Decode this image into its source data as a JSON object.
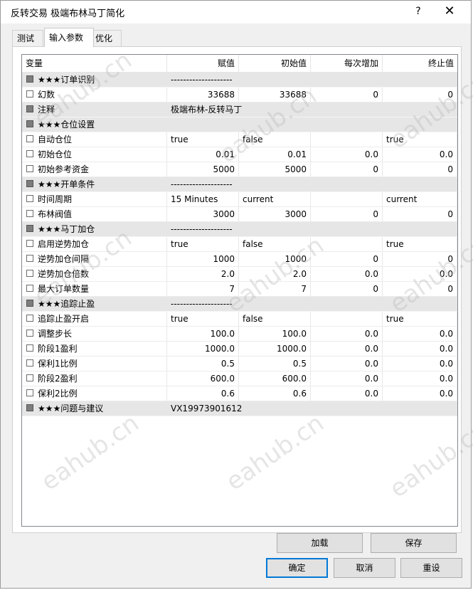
{
  "window": {
    "title": "反转交易 极端布林马丁简化",
    "help_icon": "?",
    "close_icon": "✕"
  },
  "tabs": [
    "测试",
    "输入参数",
    "优化"
  ],
  "table": {
    "headers": [
      "变量",
      "赋值",
      "初始值",
      "每次增加",
      "终止值"
    ],
    "rows": [
      {
        "group": true,
        "name": "★★★订单识别",
        "value": "--------------------",
        "start": "",
        "step": "",
        "stop": ""
      },
      {
        "group": false,
        "name": "幻数",
        "value": "33688",
        "start": "33688",
        "step": "0",
        "stop": "0"
      },
      {
        "group": true,
        "name": "注释",
        "value": "极端布林-反转马丁",
        "start": "",
        "step": "",
        "stop": ""
      },
      {
        "group": true,
        "name": "★★★仓位设置",
        "value": "",
        "start": "",
        "step": "",
        "stop": ""
      },
      {
        "group": false,
        "name": "自动仓位",
        "value": "true",
        "start": "false",
        "step": "",
        "stop": "true"
      },
      {
        "group": false,
        "name": "初始仓位",
        "value": "0.01",
        "start": "0.01",
        "step": "0.0",
        "stop": "0.0"
      },
      {
        "group": false,
        "name": "初始参考资金",
        "value": "5000",
        "start": "5000",
        "step": "0",
        "stop": "0"
      },
      {
        "group": true,
        "name": "★★★开单条件",
        "value": "--------------------",
        "start": "",
        "step": "",
        "stop": ""
      },
      {
        "group": false,
        "name": "时间周期",
        "value": "15 Minutes",
        "start": "current",
        "step": "",
        "stop": "current"
      },
      {
        "group": false,
        "name": "布林阀值",
        "value": "3000",
        "start": "3000",
        "step": "0",
        "stop": "0"
      },
      {
        "group": true,
        "name": "★★★马丁加仓",
        "value": "--------------------",
        "start": "",
        "step": "",
        "stop": ""
      },
      {
        "group": false,
        "name": "启用逆势加仓",
        "value": "true",
        "start": "false",
        "step": "",
        "stop": "true"
      },
      {
        "group": false,
        "name": "逆势加仓间隔",
        "value": "1000",
        "start": "1000",
        "step": "0",
        "stop": "0"
      },
      {
        "group": false,
        "name": "逆势加仓倍数",
        "value": "2.0",
        "start": "2.0",
        "step": "0.0",
        "stop": "0.0"
      },
      {
        "group": false,
        "name": "最大订单数量",
        "value": "7",
        "start": "7",
        "step": "0",
        "stop": "0"
      },
      {
        "group": true,
        "name": "★★★追踪止盈",
        "value": "--------------------",
        "start": "",
        "step": "",
        "stop": ""
      },
      {
        "group": false,
        "name": "追踪止盈开启",
        "value": "true",
        "start": "false",
        "step": "",
        "stop": "true"
      },
      {
        "group": false,
        "name": "调整步长",
        "value": "100.0",
        "start": "100.0",
        "step": "0.0",
        "stop": "0.0"
      },
      {
        "group": false,
        "name": "阶段1盈利",
        "value": "1000.0",
        "start": "1000.0",
        "step": "0.0",
        "stop": "0.0"
      },
      {
        "group": false,
        "name": "保利1比例",
        "value": "0.5",
        "start": "0.5",
        "step": "0.0",
        "stop": "0.0"
      },
      {
        "group": false,
        "name": "阶段2盈利",
        "value": "600.0",
        "start": "600.0",
        "step": "0.0",
        "stop": "0.0"
      },
      {
        "group": false,
        "name": "保利2比例",
        "value": "0.6",
        "start": "0.6",
        "step": "0.0",
        "stop": "0.0"
      },
      {
        "group": true,
        "name": "★★★问题与建议",
        "value": "VX19973901612",
        "start": "",
        "step": "",
        "stop": ""
      }
    ]
  },
  "buttons": {
    "load": "加载",
    "save": "保存",
    "ok": "确定",
    "cancel": "取消",
    "reset": "重设"
  },
  "watermark": "eahub.cn"
}
